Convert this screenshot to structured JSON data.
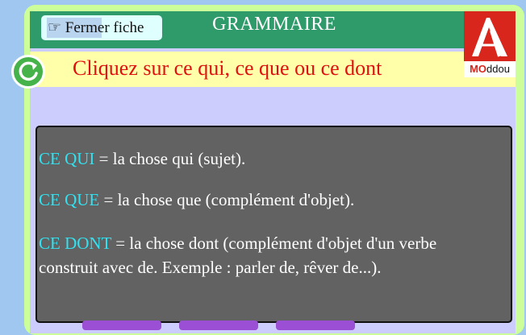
{
  "header": {
    "close_label": "Fermer fiche",
    "close_icon_glyph": "☞",
    "title": "GRAMMAIRE"
  },
  "instruction": "Cliquez sur ce qui, ce que ou ce dont",
  "logo": {
    "text_bold": "MO",
    "text_rest": "ddou"
  },
  "definitions": [
    {
      "term": "CE QUI",
      "text": " = la chose qui (sujet)."
    },
    {
      "term": "CE QUE",
      "text": " = la chose que (complément d'objet)."
    },
    {
      "term": "CE DONT",
      "text": " = la chose dont (complément d'objet d'un verbe",
      "text2": "construit avec de. Exemple : parler de, rêver de...)."
    }
  ],
  "colors": {
    "header_bg": "#2f9a6a",
    "instruction_text": "#e01010",
    "term": "#33e1f0",
    "panel_bg": "#626262"
  }
}
